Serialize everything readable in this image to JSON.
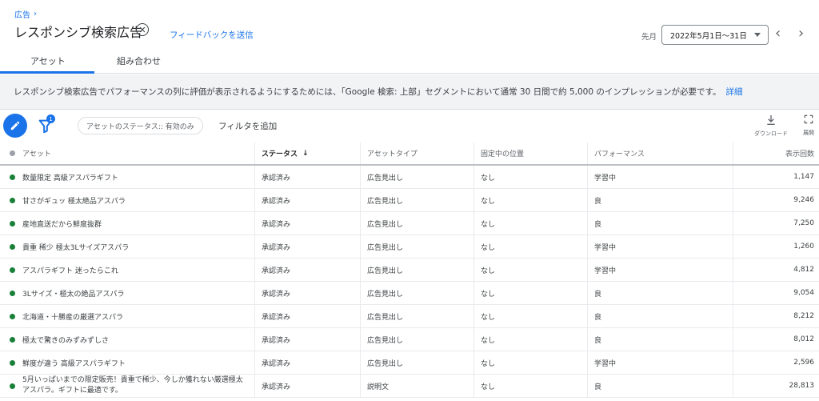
{
  "header": {
    "breadcrumb": "広告",
    "title": "レスポンシブ検索広告",
    "feedback_link": "フィードバックを送信",
    "period_label": "先月",
    "date_range": "2022年5月1日～31日"
  },
  "tabs": [
    {
      "label": "アセット",
      "active": true
    },
    {
      "label": "組み合わせ",
      "active": false
    }
  ],
  "banner": {
    "text": "レスポンシブ検索広告でパフォーマンスの列に評価が表示されるようにするためには、「Google 検索: 上部」セグメントにおいて通常 30 日間で約 5,000 のインプレッションが必要です。",
    "link": "詳細"
  },
  "toolbar": {
    "filter_count": "1",
    "status_chip": "アセットのステータス:: 有効のみ",
    "add_filter": "フィルタを追加",
    "download_label": "ダウンロード",
    "expand_label": "展開"
  },
  "table": {
    "columns": [
      "アセット",
      "ステータス",
      "アセットタイプ",
      "固定中の位置",
      "パフォーマンス",
      "表示回数"
    ],
    "rows": [
      {
        "asset": "数量限定 高級アスパラギフト",
        "status": "承認済み",
        "type": "広告見出し",
        "pinned": "なし",
        "performance": "学習中",
        "impressions": "1,147"
      },
      {
        "asset": "甘さがギュッ 極太絶品アスパラ",
        "status": "承認済み",
        "type": "広告見出し",
        "pinned": "なし",
        "performance": "良",
        "impressions": "9,246"
      },
      {
        "asset": "産地直送だから鮮度抜群",
        "status": "承認済み",
        "type": "広告見出し",
        "pinned": "なし",
        "performance": "良",
        "impressions": "7,250"
      },
      {
        "asset": "貴重 稀少 極太3Lサイズアスパラ",
        "status": "承認済み",
        "type": "広告見出し",
        "pinned": "なし",
        "performance": "学習中",
        "impressions": "1,260"
      },
      {
        "asset": "アスパラギフト 迷ったらこれ",
        "status": "承認済み",
        "type": "広告見出し",
        "pinned": "なし",
        "performance": "学習中",
        "impressions": "4,812"
      },
      {
        "asset": "3Lサイズ・極太の絶品アスパラ",
        "status": "承認済み",
        "type": "広告見出し",
        "pinned": "なし",
        "performance": "良",
        "impressions": "9,054"
      },
      {
        "asset": "北海道・十勝産の厳選アスパラ",
        "status": "承認済み",
        "type": "広告見出し",
        "pinned": "なし",
        "performance": "良",
        "impressions": "8,212"
      },
      {
        "asset": "極太で驚きのみずみずしさ",
        "status": "承認済み",
        "type": "広告見出し",
        "pinned": "なし",
        "performance": "良",
        "impressions": "8,012"
      },
      {
        "asset": "鮮度が違う 高級アスパラギフト",
        "status": "承認済み",
        "type": "広告見出し",
        "pinned": "なし",
        "performance": "学習中",
        "impressions": "2,596"
      },
      {
        "asset": "5月いっぱいまでの限定販売！貴重で稀少、今しか獲れない厳選極太アスパラ。ギフトに最適です。",
        "status": "承認済み",
        "type": "説明文",
        "pinned": "なし",
        "performance": "良",
        "impressions": "28,813"
      }
    ]
  },
  "colors": {
    "accent": "#1a73e8",
    "status_green": "#188038"
  }
}
